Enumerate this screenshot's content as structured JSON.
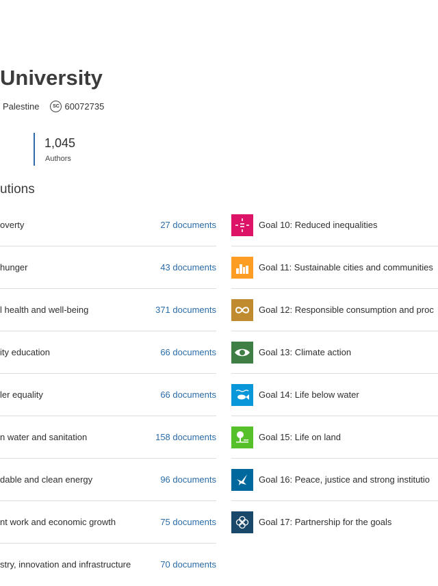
{
  "header": {
    "title": "University",
    "location": "Palestine",
    "scopus_id": "60072735"
  },
  "stats": {
    "authors_value": "1,045",
    "authors_label": "Authors"
  },
  "section": {
    "title": "utions"
  },
  "left_goals": [
    {
      "label": "overty",
      "docs": "27 documents"
    },
    {
      "label": "hunger",
      "docs": "43 documents"
    },
    {
      "label": "l health and well-being",
      "docs": "371 documents"
    },
    {
      "label": "ity education",
      "docs": "66 documents"
    },
    {
      "label": "ler equality",
      "docs": "66 documents"
    },
    {
      "label": "n water and sanitation",
      "docs": "158 documents"
    },
    {
      "label": "dable and clean energy",
      "docs": "96 documents"
    },
    {
      "label": "nt work and economic growth",
      "docs": "75 documents"
    },
    {
      "label": "stry, innovation and infrastructure",
      "docs": "70 documents"
    }
  ],
  "right_goals": [
    {
      "label": "Goal 10: Reduced inequalities",
      "color": "#dd1367",
      "icon": "reduced-inequalities-icon"
    },
    {
      "label": "Goal 11: Sustainable cities and communities",
      "color": "#fd9d24",
      "icon": "sustainable-cities-icon"
    },
    {
      "label": "Goal 12: Responsible consumption and proc",
      "color": "#bf8b2e",
      "icon": "infinity-icon"
    },
    {
      "label": "Goal 13: Climate action",
      "color": "#3f7e44",
      "icon": "climate-eye-icon"
    },
    {
      "label": "Goal 14: Life below water",
      "color": "#0a97d9",
      "icon": "fish-icon"
    },
    {
      "label": "Goal 15: Life on land",
      "color": "#56c02b",
      "icon": "tree-icon"
    },
    {
      "label": "Goal 16: Peace, justice and strong institutio",
      "color": "#00689d",
      "icon": "dove-icon"
    },
    {
      "label": "Goal 17: Partnership for the goals",
      "color": "#19486a",
      "icon": "partnership-icon"
    }
  ]
}
